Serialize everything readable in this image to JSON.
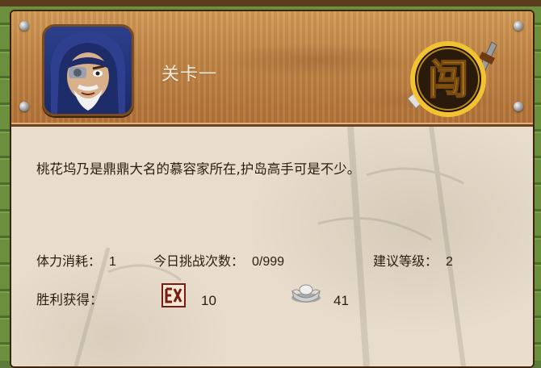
{
  "stage": {
    "title": "关卡一"
  },
  "description": "桃花坞乃是鼎鼎大名的慕容家所在,护岛高手可是不少。",
  "stats": {
    "stamina_label": "体力消耗：",
    "stamina_value": "1",
    "daily_label": "今日挑战次数：",
    "daily_value": "0/999",
    "level_label": "建议等级：",
    "level_value": "2"
  },
  "rewards": {
    "label": "胜利获得：",
    "items": [
      {
        "icon": "exp-icon",
        "value": "10"
      },
      {
        "icon": "silver-ingot-icon",
        "value": "41"
      }
    ]
  },
  "emblem": {
    "glyph": "闯"
  },
  "colors": {
    "wood": "#c08445",
    "parchment": "#e8ddcc",
    "gold": "#f2c230",
    "text": "#2a1d12",
    "title": "#f4ead8"
  }
}
